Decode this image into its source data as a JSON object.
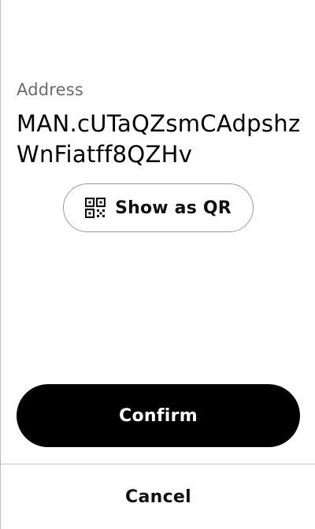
{
  "address": {
    "label": "Address",
    "value": "MAN.cUTaQZsmCAdpshzWnFiatff8QZHv"
  },
  "qr_button": {
    "icon": "qr-code-icon",
    "label": "Show as QR"
  },
  "confirm_button": {
    "label": "Confirm"
  },
  "cancel_button": {
    "label": "Cancel"
  },
  "colors": {
    "primary": "#000000",
    "label_text": "#6b6b6b",
    "outline": "#9a9a9a"
  }
}
